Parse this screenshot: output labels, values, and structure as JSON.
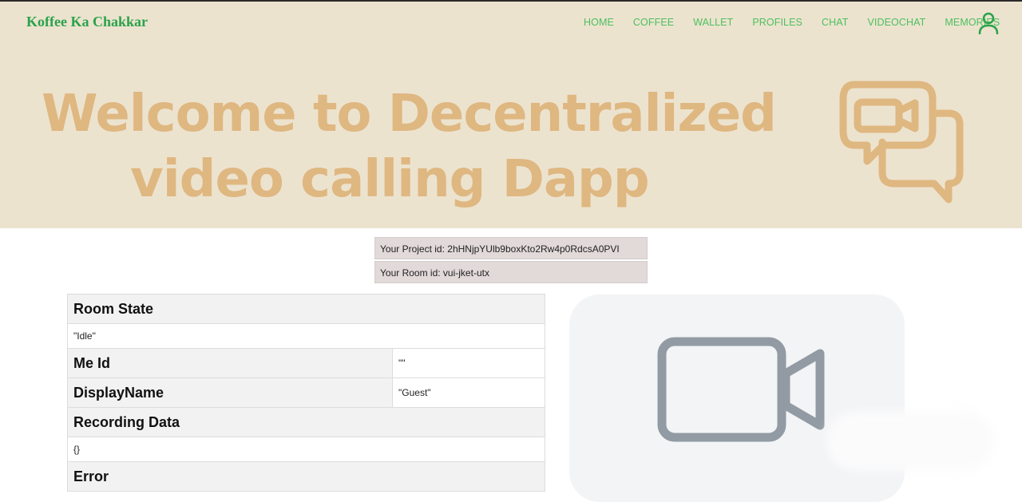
{
  "navbar": {
    "brand": "Koffee Ka Chakkar",
    "links": [
      "HOME",
      "COFFEE",
      "WALLET",
      "PROFILES",
      "CHAT",
      "VIDEOCHAT",
      "MEMORIES"
    ],
    "user_icon": "user-icon",
    "accent_color": "#2aa34a"
  },
  "hero": {
    "line1": "Welcome to Decentralized",
    "line2": "video calling Dapp",
    "icon": "video-chat-bubble-icon",
    "background": "#ece3cf",
    "text_color": "#dfb780"
  },
  "ids": {
    "project": "Your Project id: 2hHNjpYUlb9boxKto2Rw4p0RdcsA0PVI",
    "room": "Your Room id: vui-jket-utx"
  },
  "state_table": {
    "room_state_label": "Room State",
    "room_state_value": "\"Idle\"",
    "me_id_label": "Me Id",
    "me_id_value": "\"\"",
    "display_name_label": "DisplayName",
    "display_name_value": "\"Guest\"",
    "recording_label": "Recording Data",
    "recording_value": "{}",
    "error_label": "Error"
  },
  "video_panel": {
    "icon": "video-camera-icon"
  }
}
